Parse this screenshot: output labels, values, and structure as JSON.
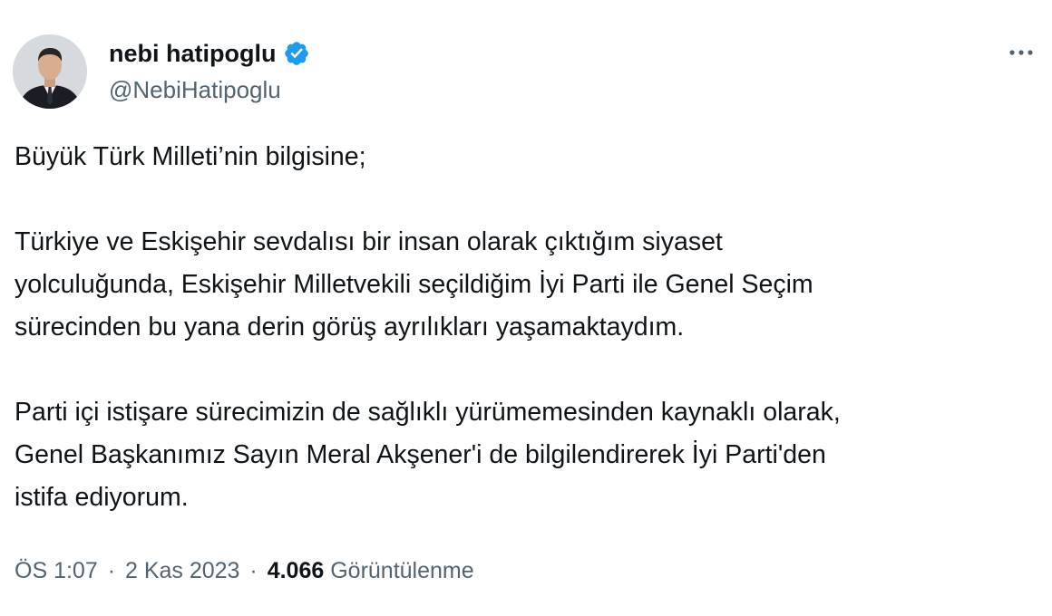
{
  "author": {
    "display_name": "nebi hatipoglu",
    "handle": "@NebiHatipoglu",
    "verified": true,
    "avatar_icon": "profile-photo",
    "verified_color": "#1d9bf0"
  },
  "menu": {
    "more_icon": "more-horizontal-icon"
  },
  "body": {
    "line1": "Büyük Türk Milleti’nin bilgisine;",
    "line2": "Türkiye ve Eskişehir sevdalısı bir insan olarak çıktığım siyaset",
    "line3": "yolculuğunda, Eskişehir Milletvekili seçildiğim İyi Parti ile Genel Seçim",
    "line4": "sürecinden bu yana derin görüş ayrılıkları yaşamaktaydım.",
    "line5": "Parti içi istişare sürecimizin de sağlıklı yürümemesinden kaynaklı olarak,",
    "line6": "Genel Başkanımız Sayın Meral Akşener'i de bilgilendirerek İyi Parti'den",
    "line7": "istifa ediyorum."
  },
  "meta": {
    "time": "ÖS 1:07",
    "separator": "·",
    "date": "2 Kas 2023",
    "views_count": "4.066",
    "views_label": "Görüntülenme"
  },
  "colors": {
    "text": "#0f1419",
    "secondary": "#536471",
    "accent": "#1d9bf0"
  }
}
